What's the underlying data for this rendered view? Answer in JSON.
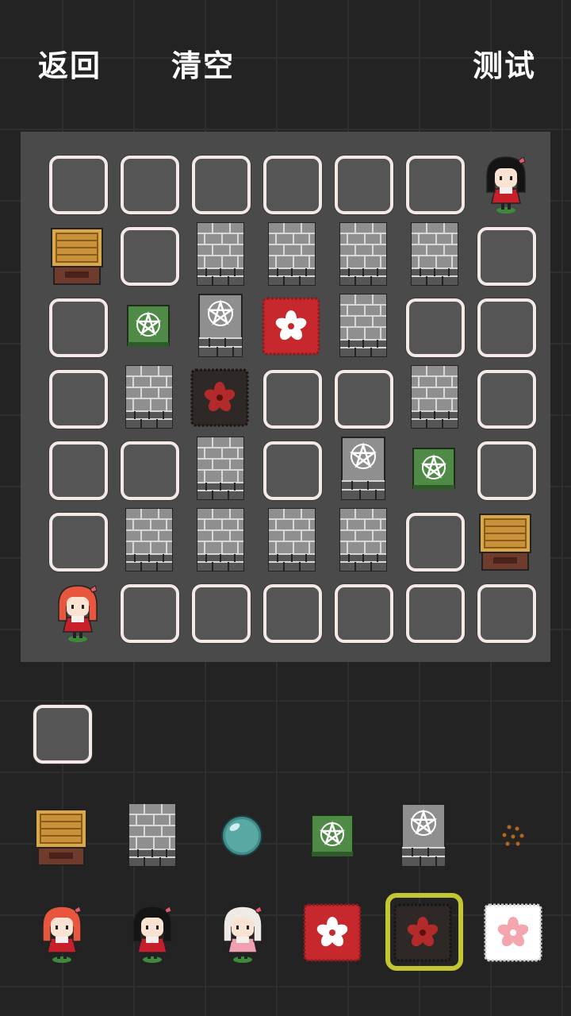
{
  "top_bar": {
    "back_label": "返回",
    "clear_label": "清空",
    "test_label": "测试"
  },
  "board": {
    "rows": 7,
    "cols": 7,
    "grid": [
      [
        "empty",
        "empty",
        "empty",
        "empty",
        "empty",
        "empty",
        "girl-black"
      ],
      [
        "crate",
        "empty",
        "wall",
        "wall",
        "wall",
        "wall",
        "empty"
      ],
      [
        "empty",
        "green-star",
        "stone-star",
        "red-flower",
        "wall",
        "empty",
        "empty"
      ],
      [
        "empty",
        "wall",
        "dark-flower",
        "empty",
        "empty",
        "wall",
        "empty"
      ],
      [
        "empty",
        "empty",
        "wall",
        "empty",
        "stone-star",
        "green-star",
        "empty"
      ],
      [
        "empty",
        "wall",
        "wall",
        "wall",
        "wall",
        "empty",
        "crate"
      ],
      [
        "girl-red",
        "empty",
        "empty",
        "empty",
        "empty",
        "empty",
        "empty"
      ]
    ]
  },
  "palette": {
    "row1": [
      "empty"
    ],
    "row2": [
      "crate",
      "wall",
      "bubble",
      "green-star",
      "stone-star",
      "seeds"
    ],
    "row3": [
      "girl-red",
      "girl-black",
      "girl-white",
      "red-flower",
      "dark-flower",
      "white-flower"
    ],
    "selected": "dark-flower"
  },
  "colors": {
    "background": "#232323",
    "board": "#4a4a4a",
    "slot_border": "#f4e9e6",
    "selection": "#c3c630",
    "green_tile": "#4f8a46",
    "red_tile": "#c7282d",
    "dark_tile": "#2e2827"
  }
}
